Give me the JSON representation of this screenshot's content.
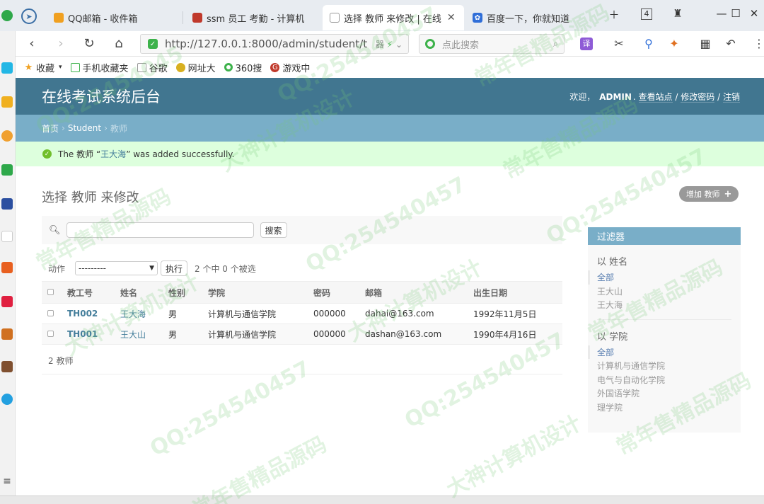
{
  "browser": {
    "tabs": [
      {
        "label": "QQ邮箱 - 收件箱",
        "icon": "qq-mail-icon"
      },
      {
        "label": "ssm 员工 考勤 - 计算机",
        "icon": "site-icon"
      },
      {
        "label": "选择 教师 来修改 | 在线",
        "icon": "page-icon",
        "active": true
      },
      {
        "label": "百度一下，你就知道",
        "icon": "baidu-icon"
      }
    ],
    "tab_counter": "4",
    "url": "http://127.0.0.1:8000/admin/student/t",
    "url_suffix": "器",
    "search_placeholder": "点此搜索",
    "translate_label": "译",
    "bookmarks": [
      {
        "label": "收藏",
        "icon": "star-icon"
      },
      {
        "label": "手机收藏夹",
        "icon": "phone-icon"
      },
      {
        "label": "谷歌",
        "icon": "page-icon"
      },
      {
        "label": "网址大",
        "icon": "nav-icon"
      },
      {
        "label": "360搜",
        "icon": "search-360-icon"
      },
      {
        "label": "游戏中",
        "icon": "game-icon"
      }
    ]
  },
  "admin": {
    "site_title": "在线考试系统后台",
    "user_tools": {
      "welcome": "欢迎，",
      "username": "ADMIN",
      "view_site": "查看站点",
      "change_password": "修改密码",
      "logout": "注销",
      "sep": "/"
    },
    "breadcrumbs": {
      "home": "首页",
      "app": "Student",
      "model": "教师",
      "sep": "›"
    },
    "message": {
      "prefix": "The 教师 “",
      "object": "王大海",
      "suffix": "” was added successfully."
    },
    "page_title": "选择 教师 来修改",
    "add_button": "增加 教师",
    "search": {
      "value": "",
      "button": "搜索"
    },
    "actions": {
      "label": "动作",
      "selected": "---------",
      "go": "执行",
      "counter": "2 个中 0 个被选"
    },
    "table": {
      "headers": [
        "教工号",
        "姓名",
        "性别",
        "学院",
        "密码",
        "邮箱",
        "出生日期"
      ],
      "rows": [
        {
          "id": "TH002",
          "name": "王大海",
          "gender": "男",
          "college": "计算机与通信学院",
          "password": "000000",
          "email": "dahai@163.com",
          "birthday": "1992年11月5日"
        },
        {
          "id": "TH001",
          "name": "王大山",
          "gender": "男",
          "college": "计算机与通信学院",
          "password": "000000",
          "email": "dashan@163.com",
          "birthday": "1990年4月16日"
        }
      ]
    },
    "paginator": "2 教师",
    "filter": {
      "title": "过滤器",
      "groups": [
        {
          "title": "以 姓名",
          "items": [
            "全部",
            "王大山",
            "王大海"
          ]
        },
        {
          "title": "以 学院",
          "items": [
            "全部",
            "计算机与通信学院",
            "电气与自动化学院",
            "外国语学院",
            "理学院"
          ]
        }
      ]
    }
  },
  "watermarks": [
    "QQ:25454045",
    "常年售精品源码",
    "大神计算机设计",
    "QQ:254540457"
  ]
}
